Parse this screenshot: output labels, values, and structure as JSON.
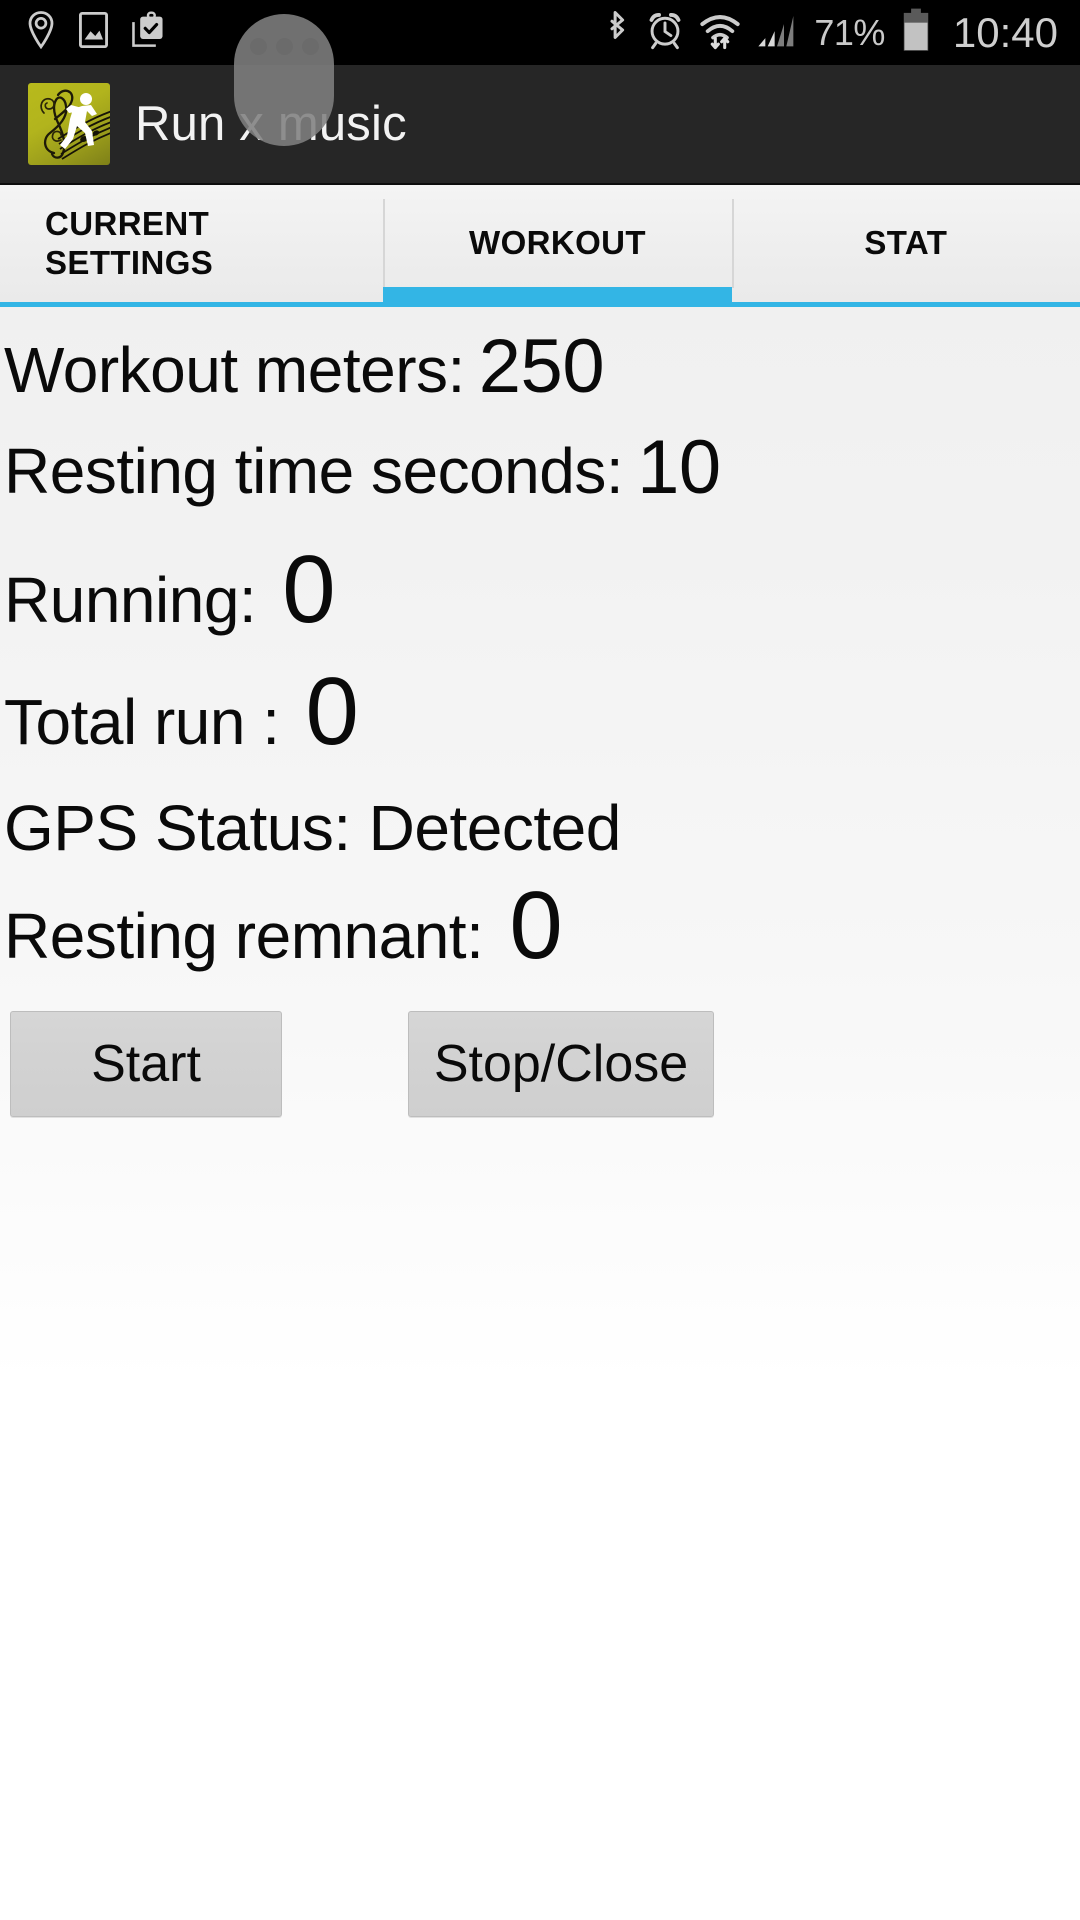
{
  "status_bar": {
    "left_icons": [
      "location-pin-icon",
      "photo-icon",
      "clipboard-check-icon"
    ],
    "right_icons": [
      "bluetooth-icon",
      "alarm-clock-icon",
      "wifi-icon",
      "cellular-signal-icon"
    ],
    "battery_percent": "71%",
    "time": "10:40",
    "bubble_icon": "overflow-dots-bubble"
  },
  "action_bar": {
    "app_icon": "run-x-music-app-icon",
    "title": "Run x music"
  },
  "tabs": {
    "items": [
      {
        "label": "CURRENT SETTINGS",
        "name": "tab-current-settings",
        "selected": false
      },
      {
        "label": "WORKOUT",
        "name": "tab-workout",
        "selected": true
      },
      {
        "label": "STAT",
        "name": "tab-stat",
        "selected": false
      }
    ],
    "indicator_color": "#33b5e5"
  },
  "workout": {
    "workout_meters_label": "Workout meters:",
    "workout_meters_value": "250",
    "resting_time_label": "Resting time seconds:",
    "resting_time_value": "10",
    "running_label": "Running:",
    "running_value": "0",
    "total_run_label": "Total run :",
    "total_run_value": "0",
    "gps_status_label": "GPS Status:",
    "gps_status_value": "Detected",
    "resting_remnant_label": "Resting remnant:",
    "resting_remnant_value": "0"
  },
  "buttons": {
    "start": "Start",
    "stop_close": "Stop/Close"
  },
  "colors": {
    "accent": "#33b5e5",
    "action_bar_bg": "#262626",
    "status_bar_bg": "#000000",
    "app_icon_bg": "#b2b41d",
    "button_bg": "#d2d2d2"
  }
}
